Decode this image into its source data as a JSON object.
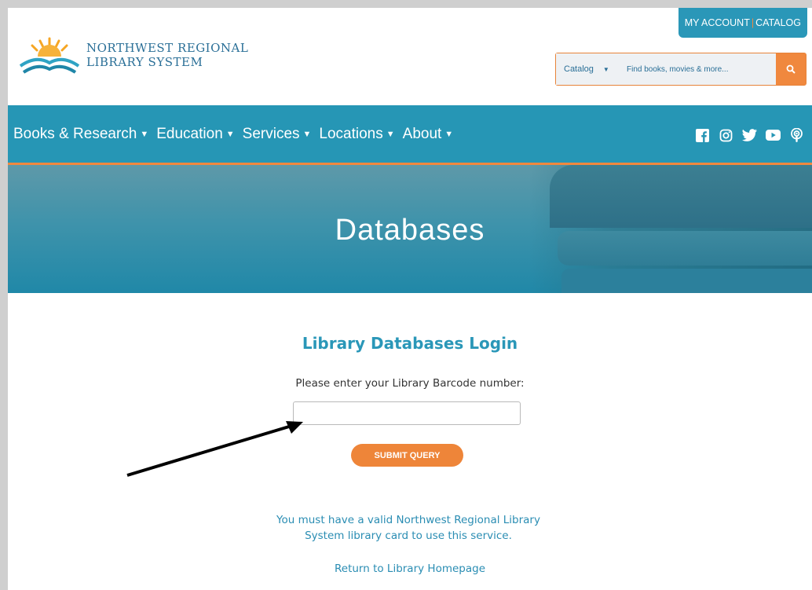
{
  "header": {
    "logo_line1": "NORTHWEST REGIONAL",
    "logo_line2": "LIBRARY SYSTEM",
    "account_link": "MY ACCOUNT",
    "separator": "|",
    "catalog_link": "CATALOG"
  },
  "search": {
    "scope": "Catalog",
    "placeholder": "Find books, movies & more..."
  },
  "nav": {
    "items": [
      {
        "label": "Books & Research"
      },
      {
        "label": "Education"
      },
      {
        "label": "Services"
      },
      {
        "label": "Locations"
      },
      {
        "label": "About"
      }
    ],
    "social_icons": [
      "facebook-icon",
      "instagram-icon",
      "twitter-icon",
      "youtube-icon",
      "podcast-icon"
    ]
  },
  "hero": {
    "title": "Databases"
  },
  "login": {
    "title": "Library Databases Login",
    "prompt": "Please enter your Library Barcode number:",
    "barcode_value": "",
    "submit_label": "SUBMIT QUERY",
    "notice_line1": "You must have a valid Northwest Regional Library",
    "notice_line2": "System library card to use this service.",
    "home_link": "Return to Library Homepage"
  },
  "colors": {
    "primary_blue": "#2696b5",
    "accent_orange": "#f0883e"
  }
}
